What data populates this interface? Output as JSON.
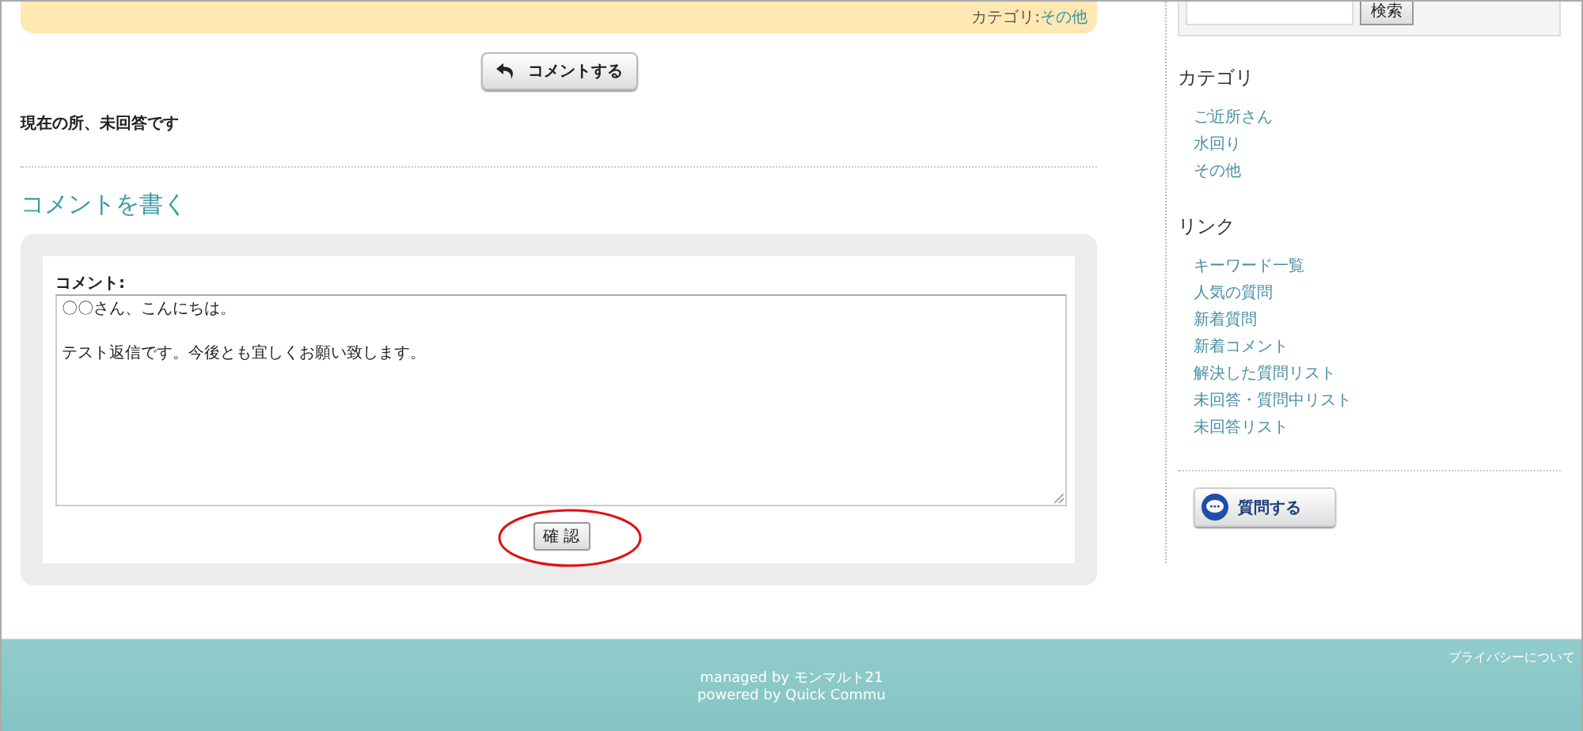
{
  "category_bar": {
    "label": "カテゴリ:",
    "value": "その他"
  },
  "comment_button": "コメントする",
  "status_text": "現在の所、未回答です",
  "comment_form": {
    "heading": "コメントを書く",
    "field_label": "コメント:",
    "lines": [
      "〇〇さん、こんにちは。",
      "テスト返信です。今後とも宜しくお願い致します。"
    ],
    "submit": "確 認",
    "annotation_circled": true
  },
  "sidebar": {
    "search_button": "検索",
    "sections": [
      {
        "title": "カテゴリ",
        "items": [
          "ご近所さん",
          "水回り",
          "その他"
        ]
      },
      {
        "title": "リンク",
        "items": [
          "キーワード一覧",
          "人気の質問",
          "新着質問",
          "新着コメント",
          "解決した質問リスト",
          "未回答・質問中リスト",
          "未回答リスト"
        ]
      }
    ],
    "ask_button": "質問する"
  },
  "footer": {
    "privacy_link": "プライバシーについて",
    "managed_by": "managed by モンマルト21",
    "powered_by": "powered by Quick Commu"
  }
}
